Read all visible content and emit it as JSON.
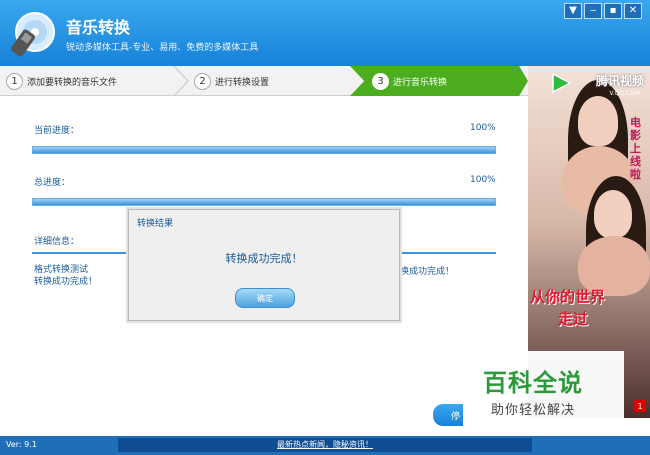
{
  "window": {
    "title": "音乐转换",
    "subtitle": "锐动多媒体工具-专业、易用、免费的多媒体工具",
    "buttons": [
      "▼",
      "‒",
      "▪",
      "✕"
    ]
  },
  "steps": [
    {
      "num": "1",
      "label": "添加要转换的音乐文件"
    },
    {
      "num": "2",
      "label": "进行转换设置"
    },
    {
      "num": "3",
      "label": "进行音乐转换"
    }
  ],
  "progress": {
    "current_label": "当前进度：",
    "current_pct": "100%",
    "current_value": 1.0,
    "total_label": "总进度：",
    "total_pct": "100%",
    "total_value": 1.0,
    "detail_label": "详细信息："
  },
  "log": {
    "line1": "格式转换测试",
    "line2": "转换成功完成！",
    "right": "换成功完成！"
  },
  "dialog": {
    "title": "转换结果",
    "message": "转换成功完成！",
    "ok_label": "确定"
  },
  "ad": {
    "brand": "腾讯视频",
    "domain": "V.QQ.COM",
    "vertical": "电影上线啦",
    "slogan1": "从你的世界",
    "slogan2": "走过",
    "badge": "1"
  },
  "watermark": {
    "title": "百科全说",
    "subtitle": "助你轻松解决"
  },
  "bottom_button": {
    "label": "停"
  },
  "status": {
    "version": "Ver: 9.1",
    "news": "最新热点新闻，隐秘资讯！"
  },
  "colors": {
    "brand_blue": "#1782d8",
    "active_step": "#4cae1e"
  }
}
